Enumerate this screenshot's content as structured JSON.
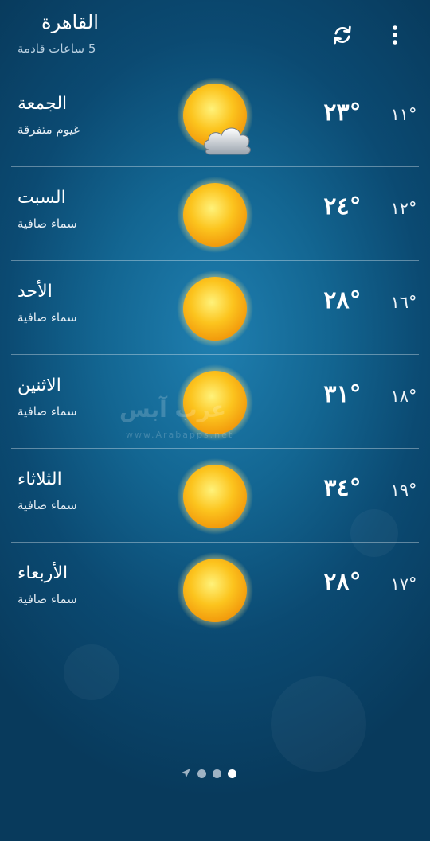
{
  "header": {
    "city": "القاهرة",
    "updated": "5 ساعات قادمة",
    "refresh_icon": "refresh-icon",
    "menu_icon": "more-vert-icon"
  },
  "forecast": [
    {
      "day": "الجمعة",
      "condition": "غيوم متفرقة",
      "high": "٢٣°",
      "low": "١١°",
      "icon": "sun-cloud-icon"
    },
    {
      "day": "السبت",
      "condition": "سماء صافية",
      "high": "٢٤°",
      "low": "١٢°",
      "icon": "sun-icon"
    },
    {
      "day": "الأحد",
      "condition": "سماء صافية",
      "high": "٢٨°",
      "low": "١٦°",
      "icon": "sun-icon"
    },
    {
      "day": "الاثنين",
      "condition": "سماء صافية",
      "high": "٣١°",
      "low": "١٨°",
      "icon": "sun-icon"
    },
    {
      "day": "الثلاثاء",
      "condition": "سماء صافية",
      "high": "٣٤°",
      "low": "١٩°",
      "icon": "sun-icon"
    },
    {
      "day": "الأربعاء",
      "condition": "سماء صافية",
      "high": "٢٨°",
      "low": "١٧°",
      "icon": "sun-icon"
    }
  ],
  "watermark": {
    "text": "عرب آبس",
    "url": "www.Arabapps.net"
  },
  "pager": {
    "count": 4,
    "active_index": 3,
    "first_icon": "location-arrow-icon"
  },
  "colors": {
    "background": "#0f5a84",
    "sun": "#fcc21a",
    "divider": "#8aa9bf"
  }
}
